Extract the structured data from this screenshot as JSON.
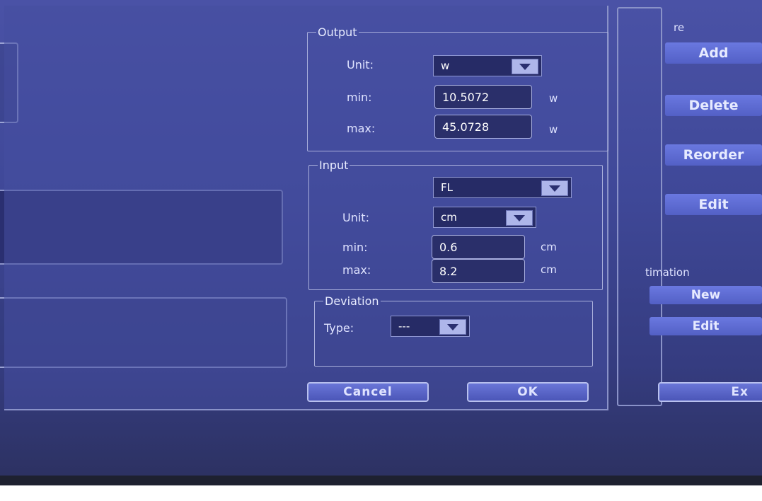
{
  "output": {
    "legend": "Output",
    "unit_label": "Unit:",
    "unit_value": "w",
    "min_label": "min:",
    "min_value": "10.5072",
    "min_unit": "w",
    "max_label": "max:",
    "max_value": "45.0728",
    "max_unit": "w"
  },
  "input": {
    "legend": "Input",
    "measure_value": "FL",
    "unit_label": "Unit:",
    "unit_value": "cm",
    "min_label": "min:",
    "min_value": "0.6",
    "min_unit": "cm",
    "max_label": "max:",
    "max_value": "8.2",
    "max_unit": "cm"
  },
  "deviation": {
    "legend": "Deviation",
    "type_label": "Type:",
    "type_value": "---"
  },
  "buttons": {
    "cancel": "Cancel",
    "ok": "OK"
  },
  "sidebar": {
    "top_label": "re",
    "add": "Add",
    "delete": "Delete",
    "reorder": "Reorder",
    "edit": "Edit",
    "estimation_label": "timation",
    "new": "New",
    "edit2": "Edit",
    "exit": "Ex"
  }
}
